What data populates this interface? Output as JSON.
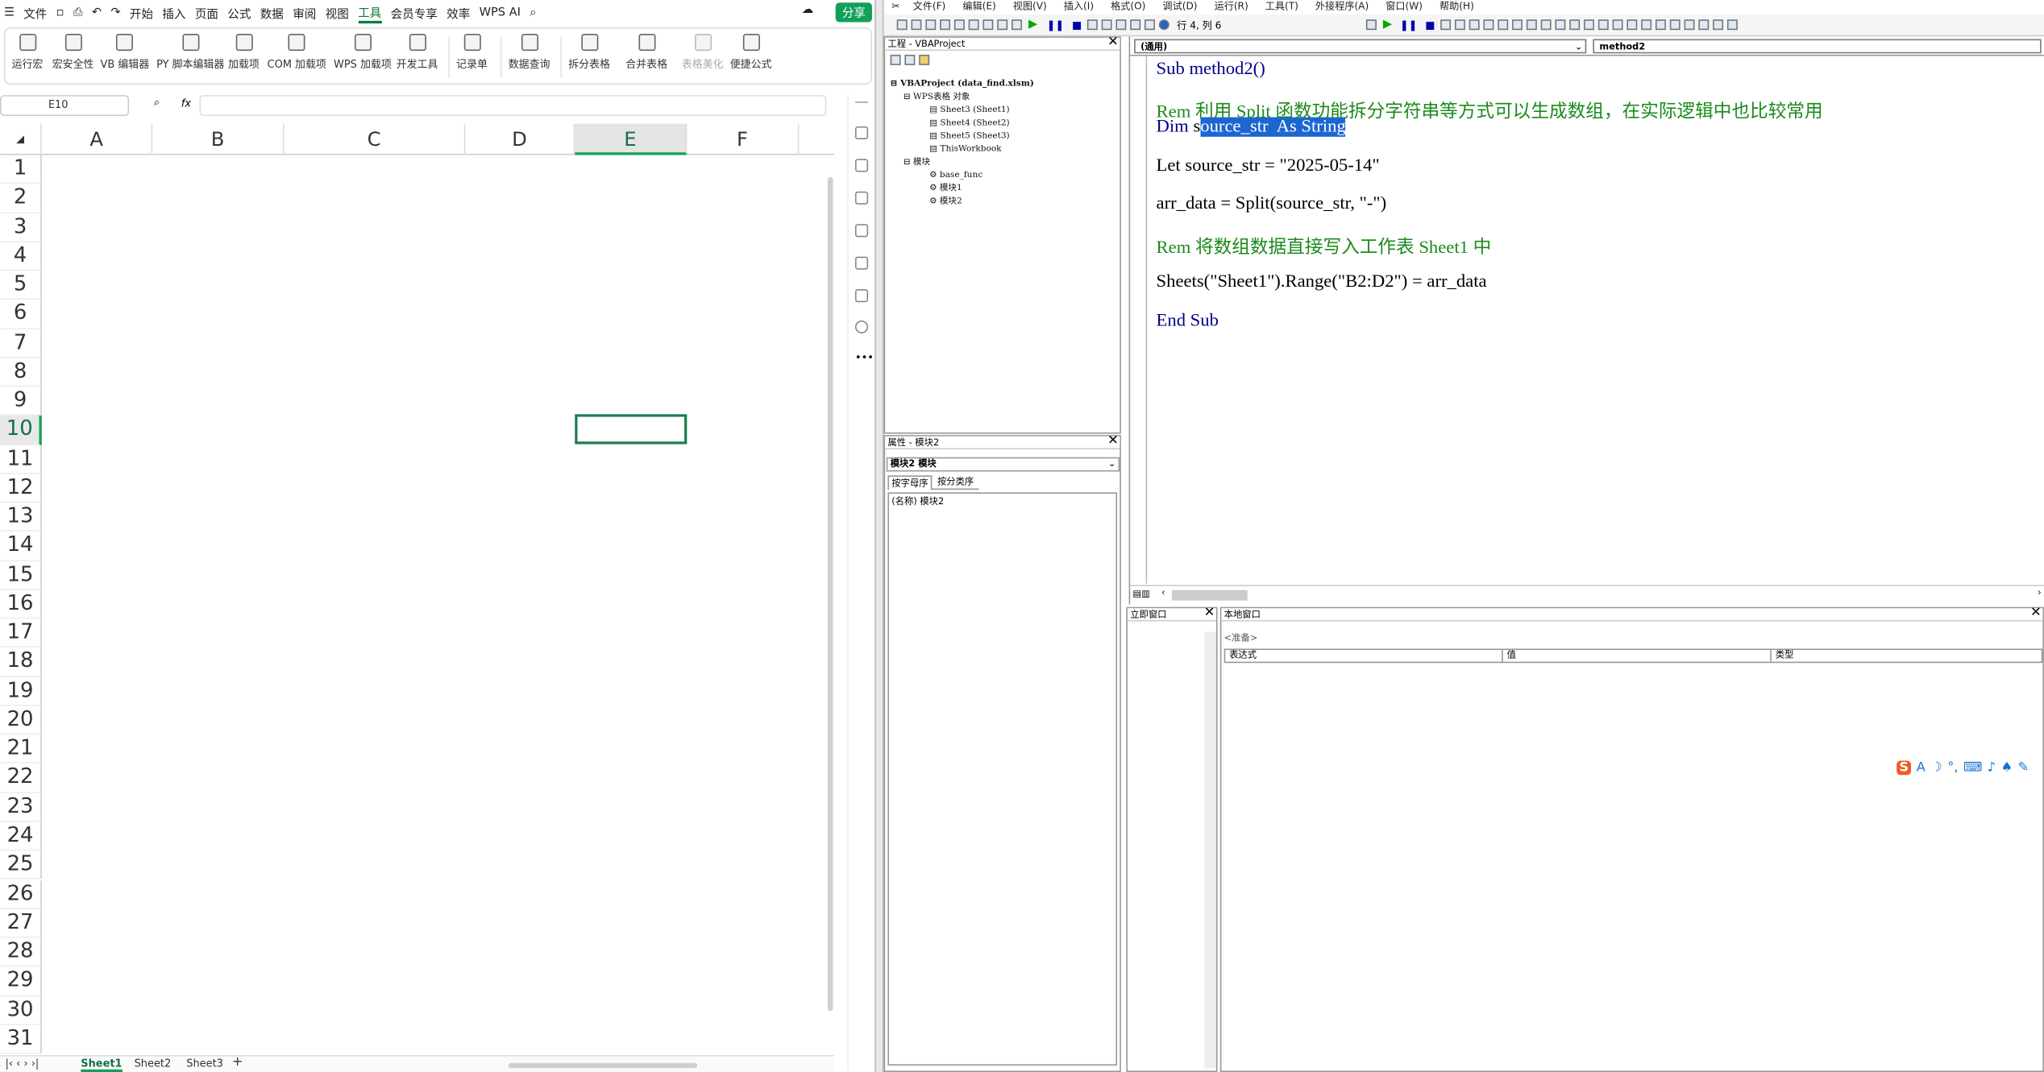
{
  "wps": {
    "file_menu": "文件",
    "tabs": [
      "开始",
      "插入",
      "页面",
      "公式",
      "数据",
      "审阅",
      "视图",
      "工具",
      "会员专享",
      "效率"
    ],
    "active_tab": "工具",
    "wps_ai": "WPS AI",
    "share": "分享",
    "ribbon": [
      "运行宏",
      "宏安全性",
      "VB 编辑器",
      "PY 脚本编辑器",
      "加载项",
      "COM 加载项",
      "WPS 加载项",
      "开发工具",
      "记录单",
      "数据查询",
      "拆分表格",
      "合并表格",
      "表格美化",
      "便捷公式"
    ],
    "namebox": "E10",
    "fx": "fx",
    "columns": [
      "A",
      "B",
      "C",
      "D",
      "E",
      "F"
    ],
    "selected_column": "E",
    "rows": [
      "1",
      "2",
      "3",
      "4",
      "5",
      "6",
      "7",
      "8",
      "9",
      "10",
      "11",
      "12",
      "13",
      "14",
      "15",
      "16",
      "17",
      "18",
      "19",
      "20",
      "21",
      "22",
      "23",
      "24",
      "25",
      "26",
      "27",
      "28",
      "29",
      "30",
      "31"
    ],
    "selected_row": "10",
    "sheets": [
      "Sheet1",
      "Sheet2",
      "Sheet3"
    ],
    "active_sheet": "Sheet1",
    "add_sheet": "+"
  },
  "vbe": {
    "menu": [
      "文件(F)",
      "编辑(E)",
      "视图(V)",
      "插入(I)",
      "格式(O)",
      "调试(D)",
      "运行(R)",
      "工具(T)",
      "外接程序(A)",
      "窗口(W)",
      "帮助(H)"
    ],
    "position": "行 4, 列 6",
    "project_title": "工程 - VBAProject",
    "tree": {
      "root": "VBAProject (data_find.xlsm)",
      "objects_folder": "WPS表格 对象",
      "objects": [
        "Sheet3 (Sheet1)",
        "Sheet4 (Sheet2)",
        "Sheet5 (Sheet3)",
        "ThisWorkbook"
      ],
      "modules_folder": "模块",
      "modules": [
        "base_func",
        "模块1",
        "模块2"
      ]
    },
    "props_title": "属性 - 模块2",
    "props_combo": "模块2 模块",
    "props_tabs": [
      "按字母序",
      "按分类序"
    ],
    "props_row": "(名称) 模块2",
    "code_combo_left": "(通用)",
    "code_combo_right": "method2",
    "code": {
      "l1": "Sub method2()",
      "l2": "Rem 利用 Split 函数功能拆分字符串等方式可以生成数组，在实际逻辑中也比较常用",
      "l3_kw": "Dim",
      "l3_pre": " s",
      "l3_sel": "ource_str  As String",
      "l4": "Let source_str = \"2025-05-14\"",
      "l5": "arr_data = Split(source_str, \"-\")",
      "l6": "Rem 将数组数据直接写入工作表 Sheet1 中",
      "l7": "Sheets(\"Sheet1\").Range(\"B2:D2\") = arr_data",
      "l8": "End Sub"
    },
    "immediate_title": "立即窗口",
    "locals_title": "本地窗口",
    "locals_ready": "<准备>",
    "locals_cols": [
      "表达式",
      "值",
      "类型"
    ]
  },
  "ime": {
    "label": "S A"
  },
  "colors": {
    "accent": "#11a05a",
    "keyword": "#00008b",
    "comment": "#1b8a1b",
    "selection": "#1c66d2"
  }
}
